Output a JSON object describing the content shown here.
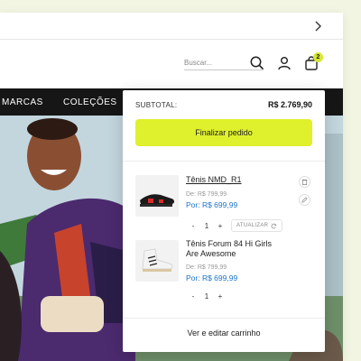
{
  "header": {
    "search_placeholder": "Buscar...",
    "cart_count": "2"
  },
  "nav": {
    "items": [
      "MARCAS",
      "COLEÇÕES"
    ]
  },
  "minicart": {
    "subtotal_label": "SUBTOTAL:",
    "subtotal_value": "R$ 2.769,90",
    "checkout_label": "Finalizar pedido",
    "items": [
      {
        "name": "Tênis NMD_R1",
        "old_price": "De: R$ 799,99",
        "price": "Por: R$ 699,99",
        "quantity": "1",
        "update_label": "ATUALIZAR"
      },
      {
        "name": "Tênis Forum 84 Hi Girls Are Awesome",
        "old_price": "De: R$ 799,99",
        "price": "Por: R$ 699,99",
        "quantity": "1"
      }
    ],
    "qty_minus": "-",
    "qty_plus": "+",
    "edit_cart_label": "Ver e editar carrinho"
  },
  "colors": {
    "accent": "#dff02c",
    "price_blue": "#1a73c8",
    "nav_bg": "#161616"
  },
  "icons": {
    "next": "chevron-right-icon",
    "search": "search-icon",
    "user": "user-icon",
    "bag": "shopping-bag-icon",
    "trash": "trash-icon",
    "edit": "pencil-icon",
    "refresh": "refresh-icon"
  }
}
